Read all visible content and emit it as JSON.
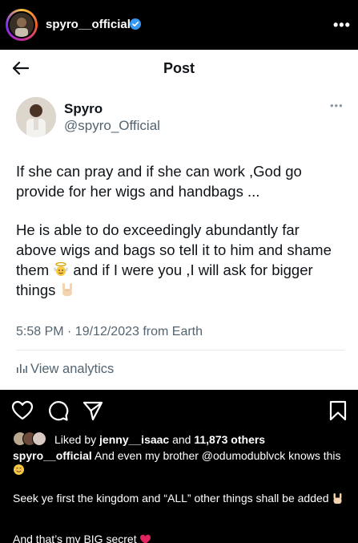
{
  "header": {
    "username": "spyro__official",
    "verified": true,
    "more_icon": "ellipsis-icon"
  },
  "tweet": {
    "title": "Post",
    "author_name": "Spyro",
    "author_handle": "@spyro_Official",
    "paragraph1": "If she can pray  and if she can work ,God go provide for her wigs and handbags ...",
    "paragraph2_part1": "He is able to do exceedingly abundantly far above wigs and bags so tell it to him and shame them",
    "paragraph2_part2": " and if I were you ,I will ask for bigger things",
    "meta": "5:58 PM · 19/12/2023 from Earth",
    "analytics": "View analytics"
  },
  "actions": {
    "like": "heart-icon",
    "comment": "comment-icon",
    "share": "send-icon",
    "save": "bookmark-icon"
  },
  "likes": {
    "prefix": "Liked by ",
    "user": "jenny__isaac",
    "middle": " and ",
    "count": "11,873 others"
  },
  "caption": {
    "username": "spyro__official",
    "line1": " And even my brother @odumodublvck knows this ",
    "line2": "Seek ye first the kingdom and “ALL” other things shall be added ",
    "line3": "And that’s my BIG secret "
  },
  "colors": {
    "verified": "#3897f0",
    "tweet_secondary": "#536471"
  }
}
